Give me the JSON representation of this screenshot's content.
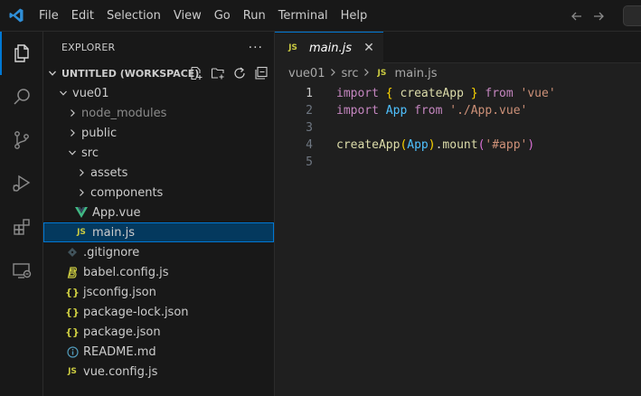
{
  "menu": {
    "items": [
      "File",
      "Edit",
      "Selection",
      "View",
      "Go",
      "Run",
      "Terminal",
      "Help"
    ]
  },
  "activity_bar": {
    "items": [
      "explorer-icon",
      "search-icon",
      "source-control-icon",
      "run-debug-icon",
      "extensions-icon",
      "remote-explorer-icon"
    ]
  },
  "sidebar": {
    "title": "EXPLORER",
    "more": "···",
    "workspace": "UNTITLED (WORKSPACE)",
    "tree": [
      {
        "label": "vue01",
        "type": "folder-open",
        "depth": 1
      },
      {
        "label": "node_modules",
        "type": "folder",
        "depth": 2,
        "dim": true
      },
      {
        "label": "public",
        "type": "folder",
        "depth": 2
      },
      {
        "label": "src",
        "type": "folder-open",
        "depth": 2
      },
      {
        "label": "assets",
        "type": "folder",
        "depth": 3
      },
      {
        "label": "components",
        "type": "folder",
        "depth": 3
      },
      {
        "label": "App.vue",
        "type": "vue",
        "depth": 3
      },
      {
        "label": "main.js",
        "type": "js",
        "depth": 3,
        "selected": true
      },
      {
        "label": ".gitignore",
        "type": "gitignore",
        "depth": 2
      },
      {
        "label": "babel.config.js",
        "type": "babel",
        "depth": 2
      },
      {
        "label": "jsconfig.json",
        "type": "json",
        "depth": 2
      },
      {
        "label": "package-lock.json",
        "type": "json",
        "depth": 2
      },
      {
        "label": "package.json",
        "type": "json",
        "depth": 2
      },
      {
        "label": "README.md",
        "type": "info",
        "depth": 2
      },
      {
        "label": "vue.config.js",
        "type": "js",
        "depth": 2
      }
    ],
    "js_badge": "JS",
    "json_badge": "{}"
  },
  "editor": {
    "tab": {
      "label": "main.js",
      "badge": "JS",
      "close": "✕"
    },
    "breadcrumb": [
      "vue01",
      "src",
      "main.js"
    ],
    "lines": [
      {
        "n": "1",
        "tokens": [
          [
            "kw",
            "import"
          ],
          [
            "pl",
            " "
          ],
          [
            "br",
            "{"
          ],
          [
            "pl",
            " "
          ],
          [
            "fn",
            "createApp"
          ],
          [
            "pl",
            " "
          ],
          [
            "br",
            "}"
          ],
          [
            "pl",
            " "
          ],
          [
            "kw",
            "from"
          ],
          [
            "pl",
            " "
          ],
          [
            "str",
            "'vue'"
          ]
        ]
      },
      {
        "n": "2",
        "tokens": [
          [
            "kw",
            "import"
          ],
          [
            "pl",
            " "
          ],
          [
            "var",
            "App"
          ],
          [
            "pl",
            " "
          ],
          [
            "kw",
            "from"
          ],
          [
            "pl",
            " "
          ],
          [
            "str",
            "'./App.vue'"
          ]
        ]
      },
      {
        "n": "3",
        "tokens": []
      },
      {
        "n": "4",
        "tokens": [
          [
            "fn",
            "createApp"
          ],
          [
            "br",
            "("
          ],
          [
            "var",
            "App"
          ],
          [
            "br",
            ")"
          ],
          [
            "pl",
            "."
          ],
          [
            "fn",
            "mount"
          ],
          [
            "pr",
            "("
          ],
          [
            "str",
            "'#app'"
          ],
          [
            "pr",
            ")"
          ]
        ]
      },
      {
        "n": "5",
        "tokens": []
      }
    ]
  },
  "colors": {
    "accent": "#0078d4",
    "vue": "#41b883",
    "js": "#cbcb41",
    "selection": "#04395e"
  }
}
